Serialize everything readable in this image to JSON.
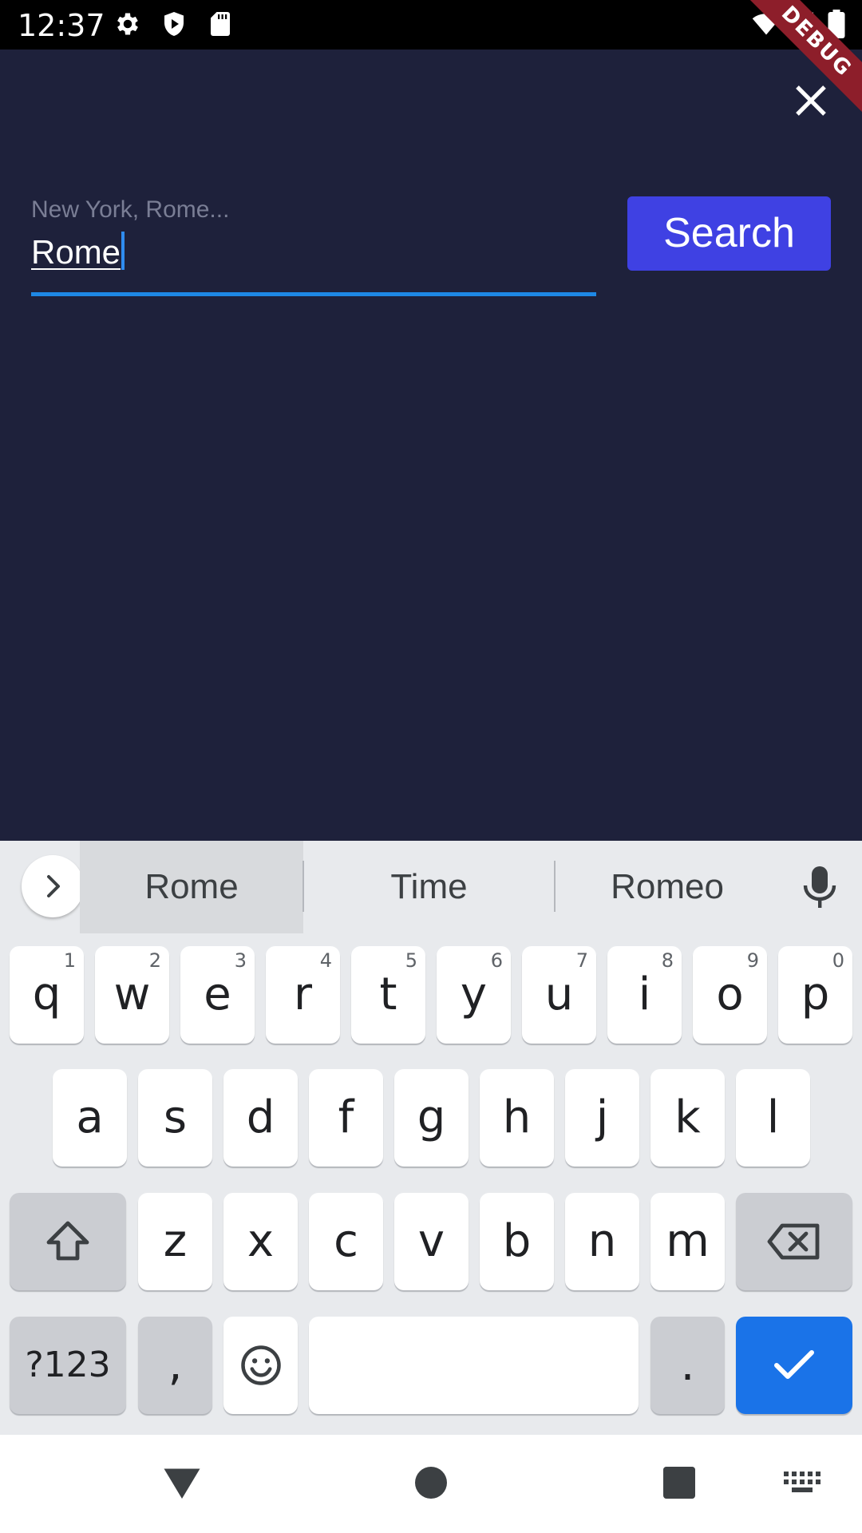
{
  "status_bar": {
    "time": "12:37",
    "icons": [
      "gear-icon",
      "shield-icon",
      "sd-card-icon",
      "wifi-icon",
      "signal-icon",
      "battery-icon"
    ]
  },
  "debug_banner": "DEBUG",
  "search": {
    "placeholder": "New York, Rome...",
    "value": "Rome",
    "button_label": "Search"
  },
  "colors": {
    "background": "#1e213b",
    "search_button": "#3f41e3",
    "field_underline": "#1e88e5",
    "enter_key": "#1a73e8"
  },
  "keyboard": {
    "suggestions": [
      "Rome",
      "Time",
      "Romeo"
    ],
    "row1": [
      {
        "letter": "q",
        "num": "1"
      },
      {
        "letter": "w",
        "num": "2"
      },
      {
        "letter": "e",
        "num": "3"
      },
      {
        "letter": "r",
        "num": "4"
      },
      {
        "letter": "t",
        "num": "5"
      },
      {
        "letter": "y",
        "num": "6"
      },
      {
        "letter": "u",
        "num": "7"
      },
      {
        "letter": "i",
        "num": "8"
      },
      {
        "letter": "o",
        "num": "9"
      },
      {
        "letter": "p",
        "num": "0"
      }
    ],
    "row2": [
      "a",
      "s",
      "d",
      "f",
      "g",
      "h",
      "j",
      "k",
      "l"
    ],
    "row3": [
      "z",
      "x",
      "c",
      "v",
      "b",
      "n",
      "m"
    ],
    "symbols_label": "?123",
    "comma": ",",
    "period": "."
  }
}
